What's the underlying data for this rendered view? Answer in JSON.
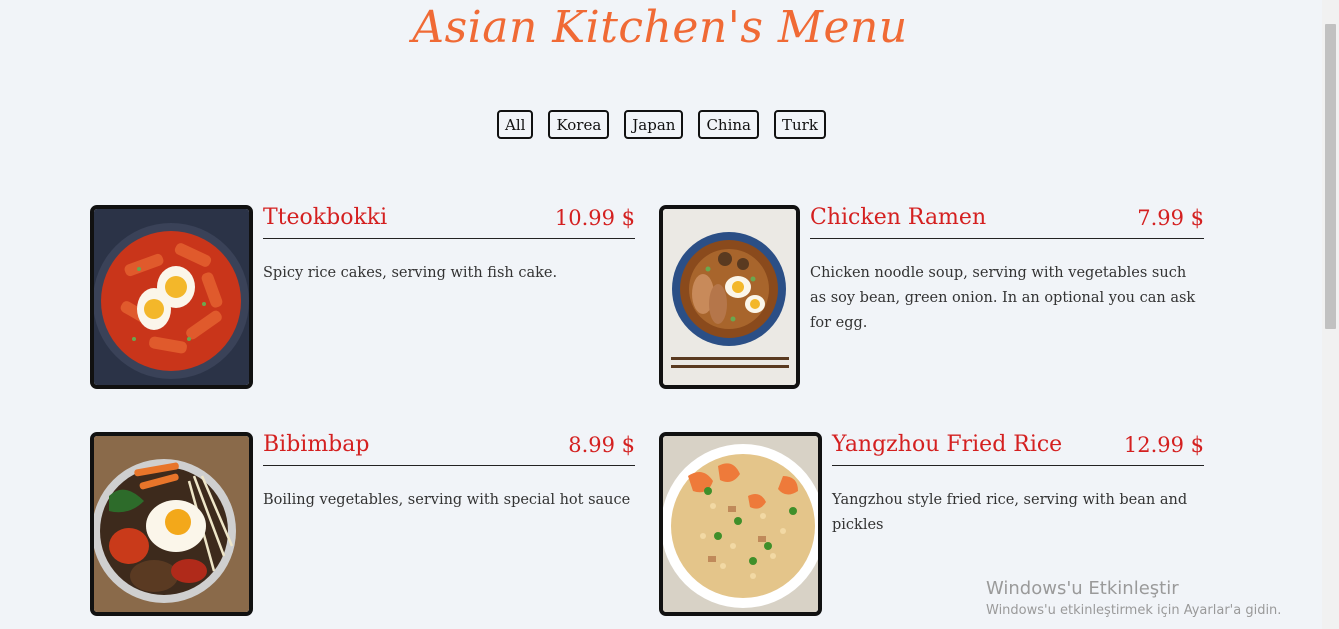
{
  "page": {
    "title": "Asian Kitchen's Menu"
  },
  "filters": [
    "All",
    "Korea",
    "Japan",
    "China",
    "Turk"
  ],
  "menu": [
    {
      "name": "Tteokbokki",
      "price": "10.99 $",
      "desc": "Spicy rice cakes, serving with fish cake.",
      "image_icon": "tteokbokki-photo"
    },
    {
      "name": "Chicken Ramen",
      "price": "7.99 $",
      "desc": "Chicken noodle soup, serving with vegetables such as soy bean, green onion. In an optional you can ask for egg.",
      "image_icon": "chicken-ramen-photo"
    },
    {
      "name": "Bibimbap",
      "price": "8.99 $",
      "desc": "Boiling vegetables, serving with special hot sauce",
      "image_icon": "bibimbap-photo"
    },
    {
      "name": "Yangzhou Fried Rice",
      "price": "12.99 $",
      "desc": "Yangzhou style fried rice, serving with bean and pickles",
      "image_icon": "fried-rice-photo"
    }
  ],
  "watermark": {
    "line1": "Windows'u Etkinleştir",
    "line2": "Windows'u etkinleştirmek için Ayarlar'a gidin."
  },
  "colors": {
    "title": "#f06a35",
    "accent": "#d42020",
    "background": "#f1f4f8"
  }
}
